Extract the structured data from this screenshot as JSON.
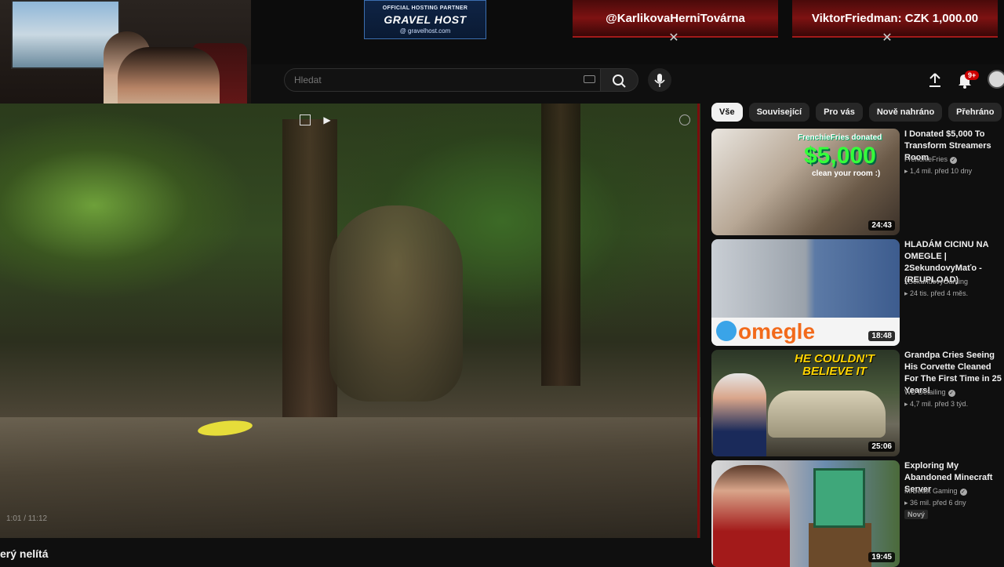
{
  "overlay": {
    "hosting_label": "OFFICIAL HOSTING PARTNER",
    "hosting_brand": "GRAVEL HOST",
    "hosting_url": "@ gravelhost.com",
    "donation_left": "@KarlikovaHerniTovárna",
    "donation_right": "ViktorFriedman: CZK 1,000.00"
  },
  "header": {
    "search_placeholder": "Hledat",
    "notification_count": "9+"
  },
  "player": {
    "time": "1:01 / 11:12",
    "title": "erý nelítá"
  },
  "chips": [
    {
      "label": "Vše",
      "active": true
    },
    {
      "label": "Související",
      "active": false
    },
    {
      "label": "Pro vás",
      "active": false
    },
    {
      "label": "Nově nahráno",
      "active": false
    },
    {
      "label": "Přehráno",
      "active": false
    }
  ],
  "recommendations": [
    {
      "title": "I Donated $5,000 To Transform Streamers Room",
      "channel": "FrenchieFries",
      "meta": "1,4 mil.  před 10 dny",
      "duration": "24:43",
      "thumb_text1": "FrenchieFries donated",
      "thumb_text2": "$5,000",
      "thumb_text3": "clean your room :)"
    },
    {
      "title": "HLADÁM CICINU NA OMEGLE | 2SekundovyMaťo - (REUPLOAD)",
      "channel": "2SekundovyGaming",
      "meta": "24 tis.  před 4 měs.",
      "duration": "18:48",
      "thumb_text1": "omegle"
    },
    {
      "title": "Grandpa Cries Seeing His Corvette Cleaned For The First Time in 25 Years!",
      "channel": "WD Detailing",
      "meta": "4,7 mil.  před 3 týd.",
      "duration": "25:06",
      "thumb_text1": "HE COULDN'T BELIEVE IT"
    },
    {
      "title": "Exploring My Abandoned Minecraft Server",
      "channel": "MrBeast Gaming",
      "meta": "36 mil.  před 6 dny",
      "duration": "19:45",
      "badge": "Nový"
    }
  ],
  "colors": {
    "background": "#0f0f0f",
    "chip_active": "#f1f1f1",
    "accent_red": "#cc0000",
    "donation_red": "#7d1212"
  }
}
